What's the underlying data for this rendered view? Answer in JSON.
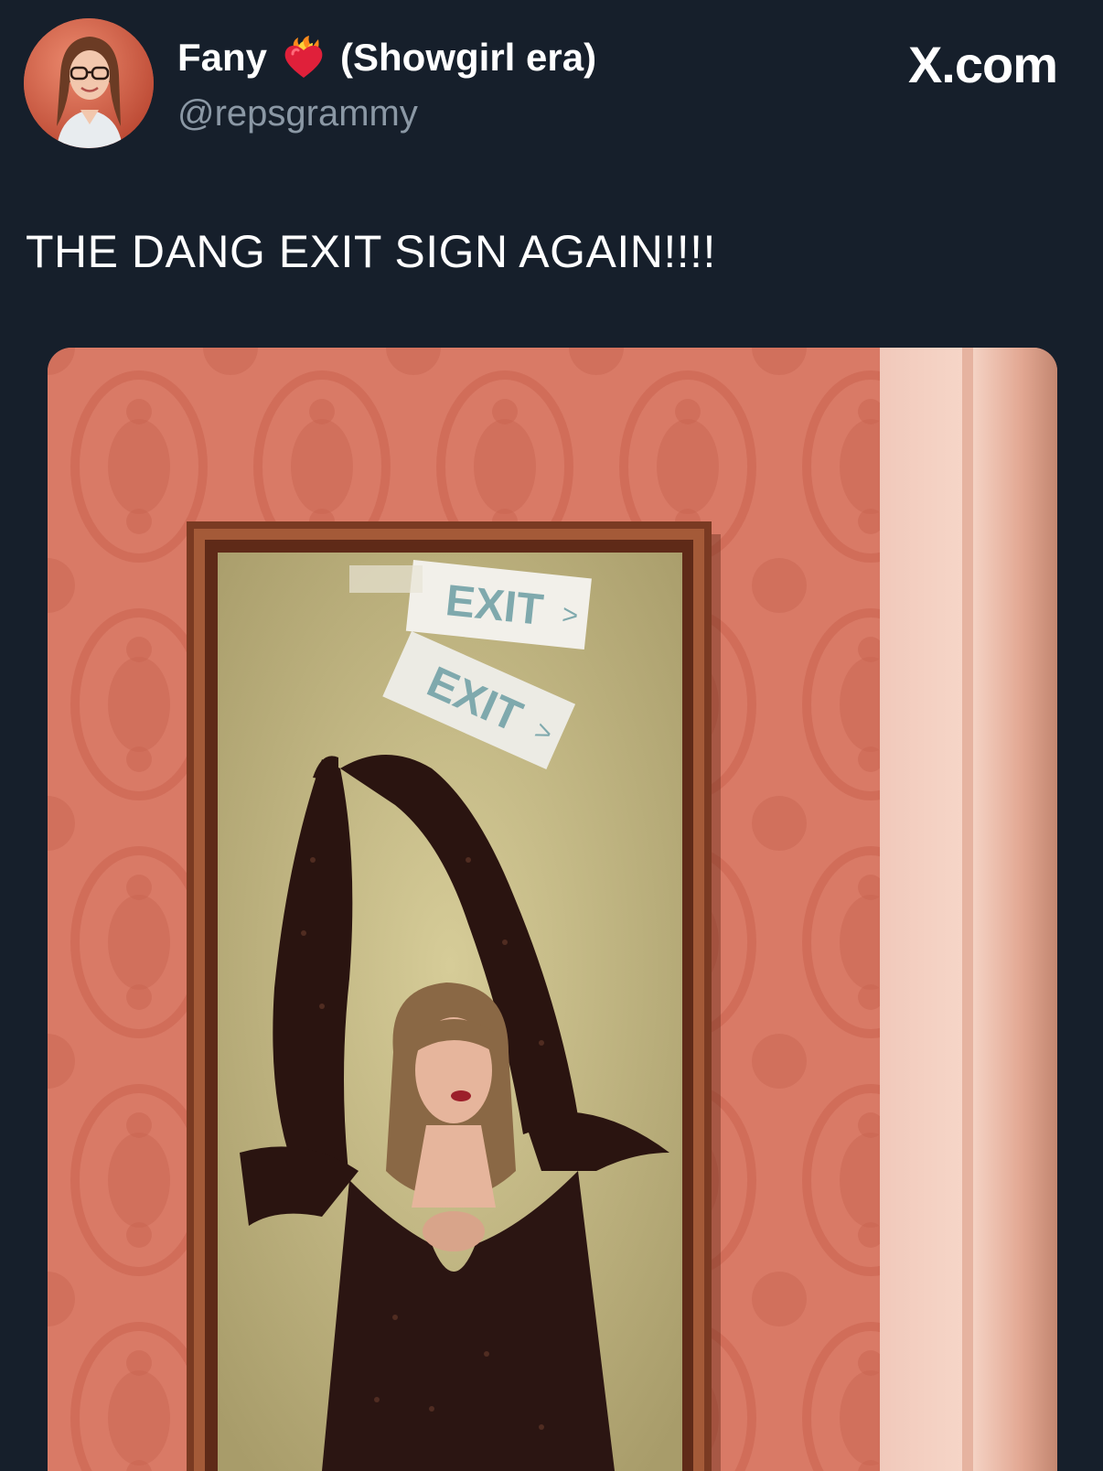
{
  "tweet": {
    "author_name": "Fany",
    "author_emoji_icon": "heart-on-fire-icon",
    "author_suffix": "(Showgirl era)",
    "handle": "@repsgrammy",
    "text": "THE DANG EXIT SIGN AGAIN!!!!"
  },
  "brand": {
    "label": "X.com"
  },
  "media": {
    "exit_sign_text": "EXIT"
  },
  "colors": {
    "background": "#161f2b",
    "handle": "#8b98a5",
    "wallpaper": "#d97a66",
    "mirror_frame": "#7a3a22"
  }
}
